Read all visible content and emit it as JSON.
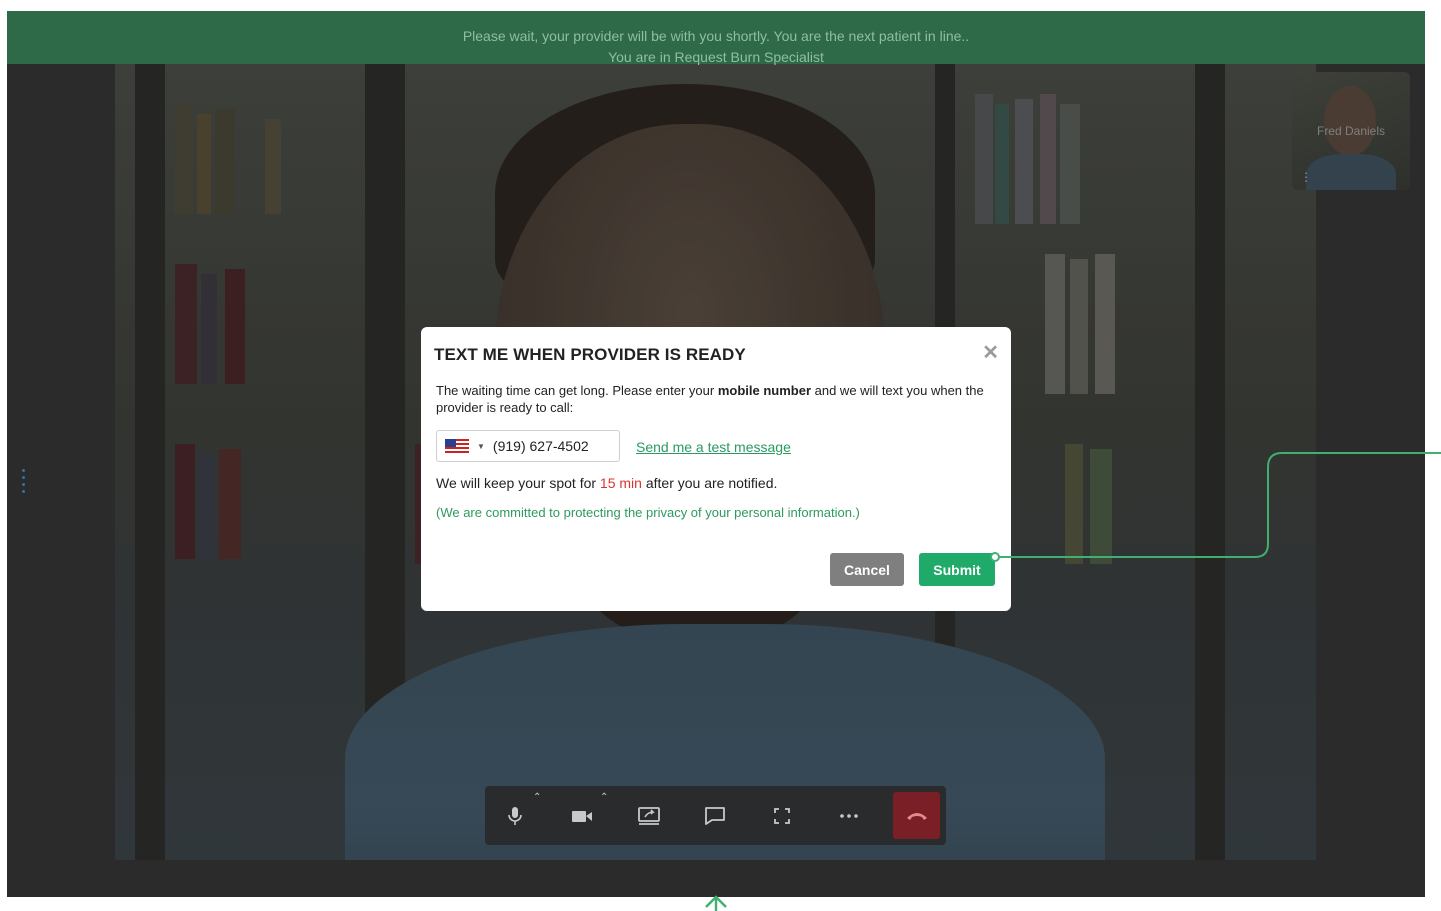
{
  "banner": {
    "line1": "Please wait, your provider will be with you shortly. You are the next patient in line..",
    "line2": "You are in Request Burn Specialist"
  },
  "participant": {
    "name": "Fred Daniels",
    "more_icon": "vertical-ellipsis-icon"
  },
  "modal": {
    "title": "TEXT ME WHEN PROVIDER IS READY",
    "close_icon": "close-icon",
    "desc_before": "The waiting time can get long. Please enter your ",
    "desc_bold": "mobile number",
    "desc_after": " and we will text you when the provider is ready to call:",
    "country_flag": "us-flag-icon",
    "phone_value": "(919) 627-4502",
    "test_link": "Send me a test message",
    "keep_before": "We will keep your spot for ",
    "keep_highlight": "15 min",
    "keep_after": " after you are notified.",
    "privacy": "(We are committed to protecting the privacy of your personal information.)",
    "cancel_label": "Cancel",
    "submit_label": "Submit",
    "highlight_color": "#d9352f",
    "accent_color": "#1faa6a"
  },
  "controls": {
    "icons": [
      "microphone-icon",
      "camera-icon",
      "screen-share-icon",
      "chat-icon",
      "fullscreen-icon",
      "more-icon",
      "hang-up-icon"
    ],
    "hangup_color": "#7a1f25"
  },
  "banner_color": "#2e6a48"
}
